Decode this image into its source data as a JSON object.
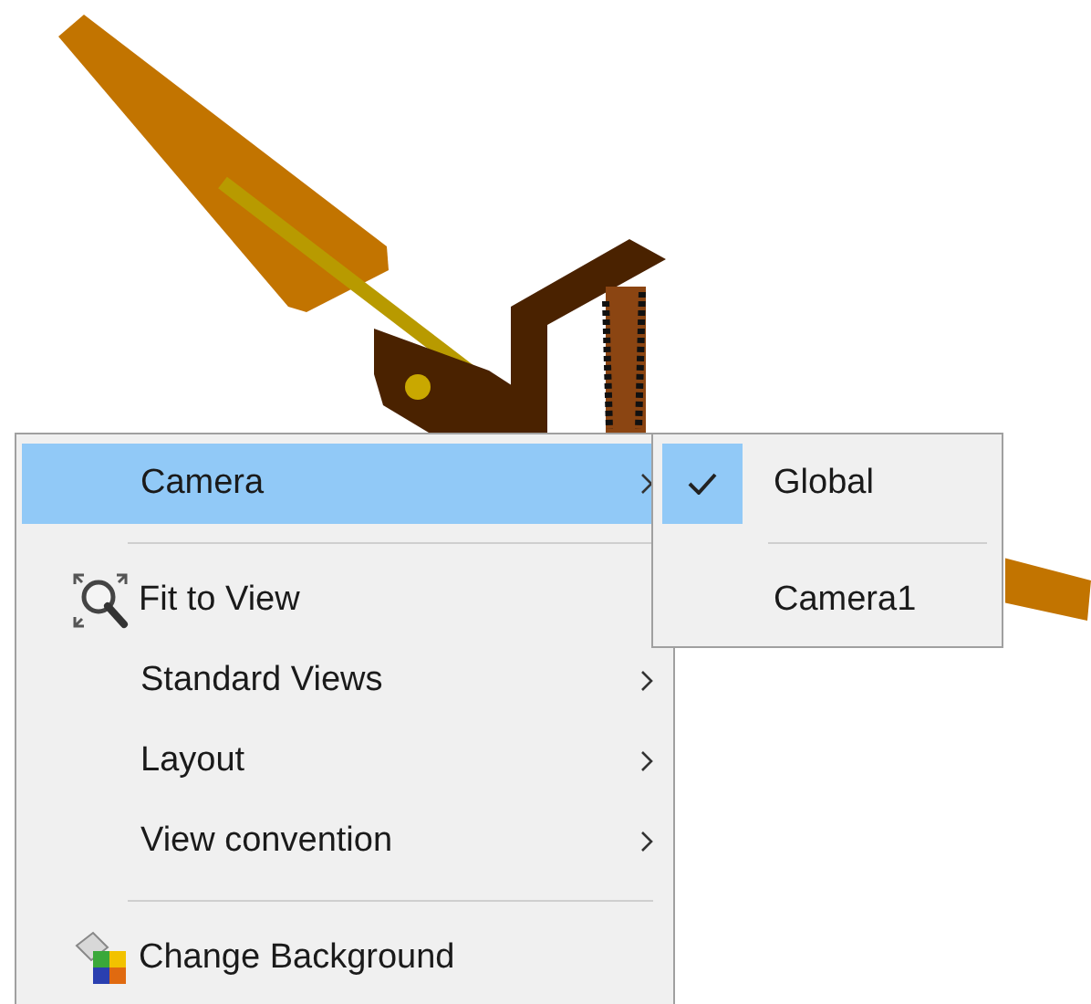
{
  "context_menu": {
    "items": [
      {
        "kind": "submenu",
        "label": "Camera",
        "selected": true
      },
      {
        "kind": "separator"
      },
      {
        "kind": "command",
        "label": "Fit to View",
        "selected": false
      },
      {
        "kind": "submenu",
        "label": "Standard Views",
        "selected": false
      },
      {
        "kind": "submenu",
        "label": "Layout",
        "selected": false
      },
      {
        "kind": "submenu",
        "label": "View convention",
        "selected": false
      },
      {
        "kind": "separator"
      },
      {
        "kind": "command",
        "label": "Change Background",
        "selected": false
      }
    ]
  },
  "camera_submenu": {
    "items": [
      {
        "kind": "option",
        "label": "Global",
        "checked": true
      },
      {
        "kind": "separator"
      },
      {
        "kind": "option",
        "label": "Camera1",
        "checked": false
      }
    ]
  }
}
